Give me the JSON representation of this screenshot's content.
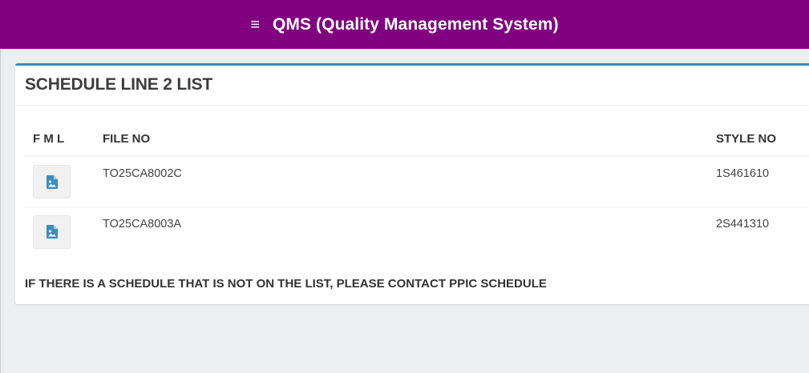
{
  "header": {
    "menu_icon": "≡",
    "title": "QMS (Quality Management System)"
  },
  "card": {
    "title": "SCHEDULE LINE 2 LIST",
    "columns": {
      "fml": "F M L",
      "file_no": "FILE NO",
      "style_no": "STYLE NO"
    },
    "rows": [
      {
        "icon": "image-file-icon",
        "file_no": "TO25CA8002C",
        "style_no": "1S461610"
      },
      {
        "icon": "image-file-icon",
        "file_no": "TO25CA8003A",
        "style_no": "2S441310"
      }
    ],
    "notice": "IF THERE IS A SCHEDULE THAT IS NOT ON THE LIST, PLEASE CONTACT PPIC SCHEDULE"
  },
  "colors": {
    "header_bg": "#800080",
    "card_accent": "#3c8dbc",
    "icon_color": "#3c8dbc",
    "page_bg": "#eceef1"
  }
}
